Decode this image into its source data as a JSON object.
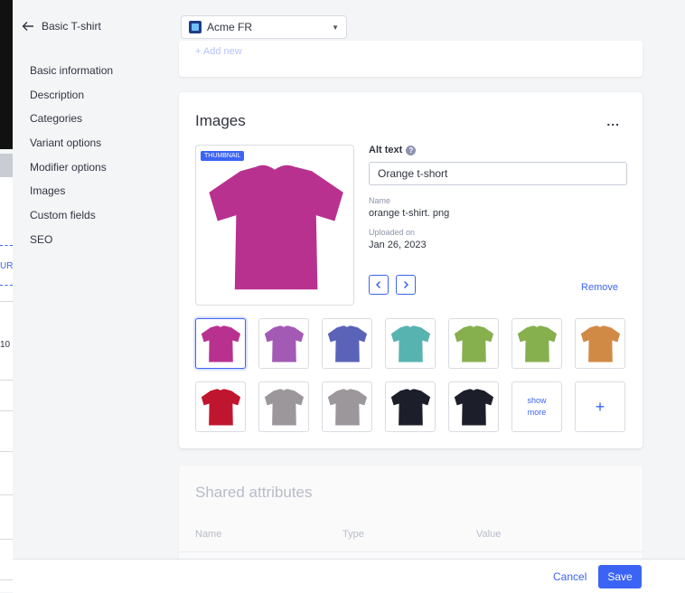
{
  "header": {
    "back_label": "Basic T-shirt",
    "store_select": "Acme FR"
  },
  "nav": {
    "items": [
      "Basic information",
      "Description",
      "Categories",
      "Variant options",
      "Modifier options",
      "Images",
      "Custom fields",
      "SEO"
    ]
  },
  "background_page": {
    "fragment_1": "URI",
    "fragment_2": "10"
  },
  "top_card": {
    "add_new_label": "+ Add new"
  },
  "images": {
    "title": "Images",
    "more_label": "...",
    "thumbnail_badge": "THUMBNAIL",
    "alt_text_label": "Alt text",
    "alt_text_value": "Orange t-short",
    "name_label": "Name",
    "name_value": "orange t-shirt. png",
    "uploaded_label": "Uploaded on",
    "uploaded_value": "Jan 26, 2023",
    "remove_label": "Remove",
    "show_more_line1": "show",
    "show_more_line2": "more",
    "add_label": "+",
    "selected_color": "#b8318f",
    "thumbnail_colors": [
      "#b8318f",
      "#a35ab5",
      "#5a63b8",
      "#56b3b0",
      "#86b04e",
      "#86b04e",
      "#d18a45",
      "#c0152e",
      "#9b979b",
      "#9b979b",
      "#1c1e2a",
      "#1c1e2a"
    ]
  },
  "shared_attributes": {
    "title": "Shared attributes",
    "col_name": "Name",
    "col_type": "Type",
    "col_value": "Value"
  },
  "footer": {
    "cancel_label": "Cancel",
    "save_label": "Save"
  },
  "colors": {
    "accent": "#3c64f4"
  }
}
